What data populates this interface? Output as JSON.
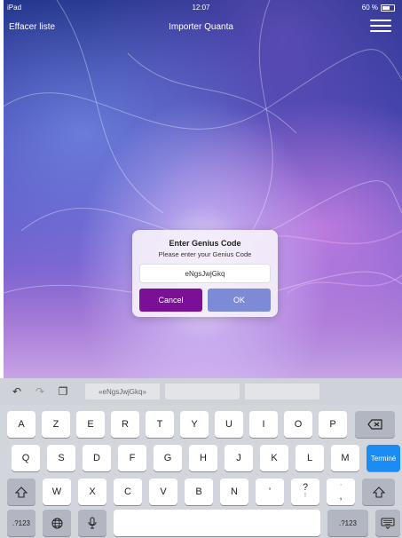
{
  "status_bar": {
    "device": "iPad",
    "time": "12:07",
    "battery_text": "60 %"
  },
  "nav": {
    "left_button": "Effacer liste",
    "title": "Importer Quanta",
    "menu_icon": "hamburger-menu-icon"
  },
  "dialog": {
    "title": "Enter Genius Code",
    "message": "Please enter your Genius Code",
    "input_value": "eNgsJwjGkq",
    "cancel_label": "Cancel",
    "ok_label": "OK",
    "colors": {
      "cancel": "#7b0f95",
      "ok": "#7d8bd6"
    }
  },
  "keyboard": {
    "suggestion": "«eNgsJwjGkq»",
    "rows": [
      [
        "A",
        "Z",
        "E",
        "R",
        "T",
        "Y",
        "U",
        "I",
        "O",
        "P"
      ],
      [
        "Q",
        "S",
        "D",
        "F",
        "G",
        "H",
        "J",
        "K",
        "L",
        "M"
      ],
      [
        "W",
        "X",
        "C",
        "V",
        "B",
        "N",
        "’",
        "?",
        ","
      ]
    ],
    "row3_alt": [
      "",
      "",
      "",
      "",
      "",
      "",
      "",
      "!",
      "’"
    ],
    "done_label": "Terminé",
    "numbers_label": ".?123",
    "accent_color": "#1a8df5"
  }
}
